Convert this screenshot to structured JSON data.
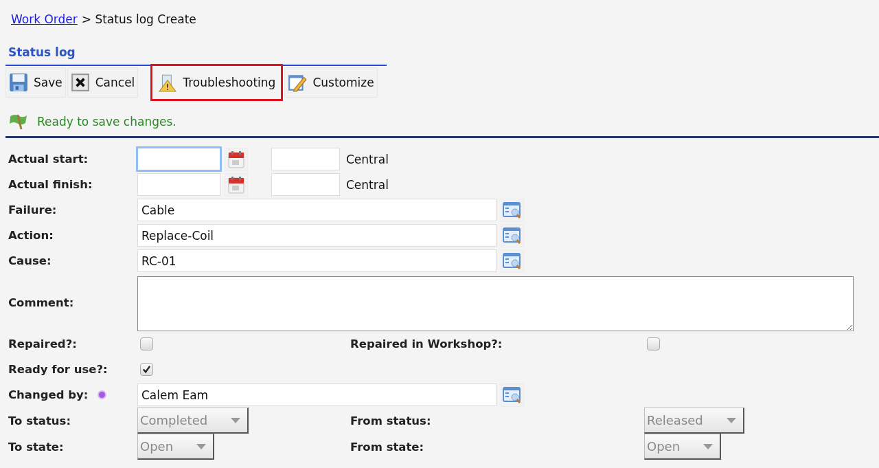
{
  "breadcrumb": {
    "link": "Work Order",
    "current": "> Status log Create"
  },
  "section_title": "Status log",
  "toolbar": [
    {
      "label": "Save",
      "kind": "save",
      "highlighted": false
    },
    {
      "label": "Cancel",
      "kind": "cancel",
      "highlighted": false
    },
    {
      "label": "Troubleshooting",
      "kind": "troubleshooting",
      "highlighted": true
    },
    {
      "label": "Customize",
      "kind": "customize",
      "highlighted": false
    }
  ],
  "status_message": "Ready to save changes.",
  "rows": [
    {
      "items": [
        {
          "kind": "datetime",
          "label": "Actual start:",
          "focused": true,
          "timezone": "Central"
        }
      ]
    },
    {
      "items": [
        {
          "kind": "datetime",
          "label": "Actual finish:",
          "focused": false,
          "timezone": "Central"
        }
      ]
    },
    {
      "items": [
        {
          "kind": "lookup",
          "label": "Failure:",
          "value": "Cable"
        }
      ]
    },
    {
      "items": [
        {
          "kind": "lookup",
          "label": "Action:",
          "value": "Replace-Coil"
        }
      ]
    },
    {
      "items": [
        {
          "kind": "lookup",
          "label": "Cause:",
          "value": "RC-01"
        }
      ]
    },
    {
      "items": [
        {
          "kind": "textarea",
          "label": "Comment:"
        }
      ]
    },
    {
      "items": [
        {
          "kind": "checkbox",
          "label": "Repaired?:",
          "checked": false
        },
        {
          "kind": "checkbox",
          "label": "Repaired in Workshop?:",
          "checked": false
        }
      ]
    },
    {
      "items": [
        {
          "kind": "checkbox",
          "label": "Ready for use?:",
          "checked": true
        }
      ]
    },
    {
      "items": [
        {
          "kind": "lookup",
          "label": "Changed by:",
          "value": "Calem Eam",
          "required": true
        }
      ]
    },
    {
      "items": [
        {
          "kind": "select",
          "label": "To status:",
          "value": "Completed",
          "disabled": true
        },
        {
          "kind": "select",
          "label": "From status:",
          "value": "Released",
          "disabled": true
        }
      ]
    },
    {
      "items": [
        {
          "kind": "select",
          "label": "To state:",
          "value": "Open",
          "disabled": true
        },
        {
          "kind": "select",
          "label": "From state:",
          "value": "Open",
          "disabled": true
        }
      ]
    }
  ]
}
